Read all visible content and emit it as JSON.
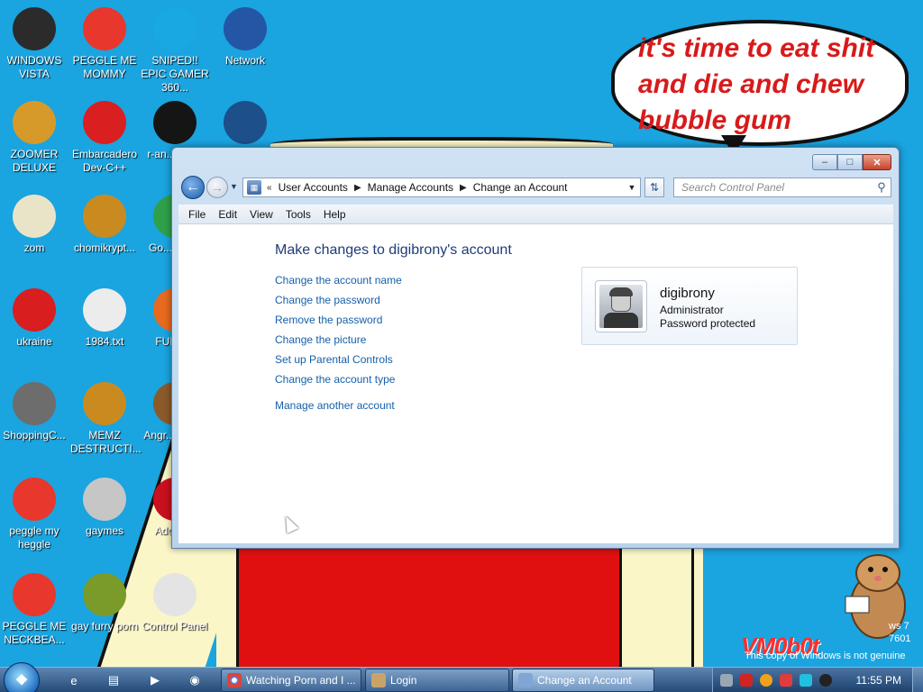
{
  "wallpaper": {
    "speech": "it's time to eat shit and die and chew bubble gum",
    "logo": "VM0b0t",
    "genuine_notice": "This copy of Windows is not genuine",
    "build_text": "ws 7\n7601"
  },
  "desktop_icons": [
    {
      "label": "WINDOWS VISTA",
      "icon": "vista-orb-icon",
      "color": "#2b2b2b"
    },
    {
      "label": "PEGGLE ME MOMMY",
      "icon": "peggle-icon",
      "color": "#e8372c"
    },
    {
      "label": "SNIPED!! EPIC GAMER 360...",
      "icon": "skype-icon",
      "color": "#18a9e3"
    },
    {
      "label": "Network",
      "icon": "network-globe-icon",
      "color": "#2456a6"
    },
    {
      "label": "ZOOMER DELUXE",
      "icon": "zuma-icon",
      "color": "#d69a2a"
    },
    {
      "label": "Embarcadero Dev-C++",
      "icon": "devcpp-icon",
      "color": "#d91f1f"
    },
    {
      "label": "r-an... par...",
      "icon": "dark-disc-icon",
      "color": "#151515"
    },
    {
      "label": "",
      "icon": "monitor-icon",
      "color": "#1d4f8a"
    },
    {
      "label": "zom",
      "icon": "flower-icon",
      "color": "#e9e4c8"
    },
    {
      "label": "chomikrypt...",
      "icon": "hourglass-file-icon",
      "color": "#c98b20"
    },
    {
      "label": "Go... Chr...",
      "icon": "chrome-icon",
      "color": "#2ea04a"
    },
    {
      "label": "ukraine",
      "icon": "radiation-icon",
      "color": "#d81e1e"
    },
    {
      "label": "1984.txt",
      "icon": "text-file-icon",
      "color": "#ececec"
    },
    {
      "label": "FURR...",
      "icon": "firefox-icon",
      "color": "#e76a1f"
    },
    {
      "label": "ShoppingC...",
      "icon": "flash-icon",
      "color": "#6d6d6d"
    },
    {
      "label": "MEMZ DESTRUCTI...",
      "icon": "hourglass-file-icon",
      "color": "#c98b20"
    },
    {
      "label": "Angr... Sea...",
      "icon": "angry-birds-icon",
      "color": "#8a5a2b"
    },
    {
      "label": "peggle my heggle",
      "icon": "peggle-icon",
      "color": "#e8372c"
    },
    {
      "label": "gaymes",
      "icon": "games-folder-icon",
      "color": "#c6c6c6"
    },
    {
      "label": "Adobe...",
      "icon": "adobe-icon",
      "color": "#c8101e"
    },
    {
      "label": "PEGGLE ME NECKBEA...",
      "icon": "peggle-icon",
      "color": "#e8372c"
    },
    {
      "label": "gay furry porn",
      "icon": "box-beaver-icon",
      "color": "#7a9a2a"
    },
    {
      "label": "Control Panel",
      "icon": "control-panel-icon",
      "color": "#e4e4e4"
    }
  ],
  "window": {
    "buttons": {
      "minimize": "–",
      "maximize": "□",
      "close": "✕"
    },
    "breadcrumbs": [
      "User Accounts",
      "Manage Accounts",
      "Change an Account"
    ],
    "breadcrumb_prefix": "«",
    "search_placeholder": "Search Control Panel",
    "menu": [
      "File",
      "Edit",
      "View",
      "Tools",
      "Help"
    ],
    "page_title": "Make changes to digibrony's account",
    "tasks": [
      "Change the account name",
      "Change the password",
      "Remove the password",
      "Change the picture",
      "Set up Parental Controls",
      "Change the account type"
    ],
    "manage_other": "Manage another account",
    "user": {
      "name": "digibrony",
      "role": "Administrator",
      "protection": "Password protected"
    }
  },
  "taskbar": {
    "start_icon": "windows-logo-icon",
    "quick_launch": [
      "internet-explorer-icon",
      "explorer-folder-icon",
      "media-player-icon",
      "firefox-icon"
    ],
    "tasks": [
      {
        "label": "Watching Porn and I ...",
        "icon": "chrome-icon",
        "active": false
      },
      {
        "label": "Login",
        "icon": "user-accounts-icon",
        "active": false
      },
      {
        "label": "Change an Account",
        "icon": "control-panel-icon",
        "active": true
      }
    ],
    "tray_icons": [
      "network-icon",
      "antivirus-icon",
      "volume-icon",
      "flag-icon",
      "display-icon",
      "power-icon"
    ],
    "clock": "11:55 PM"
  }
}
